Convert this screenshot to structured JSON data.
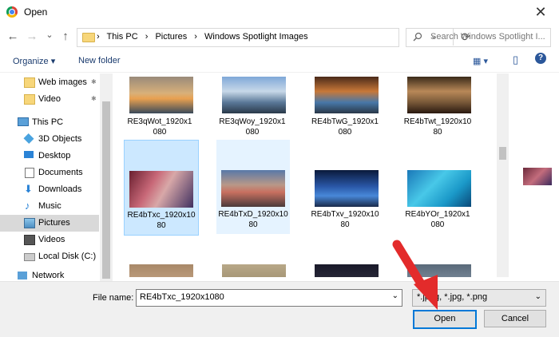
{
  "window": {
    "title": "Open",
    "close_glyph": "✕"
  },
  "nav": {
    "back": "←",
    "forward": "→",
    "recent": "⌄",
    "up": "↑"
  },
  "address": {
    "crumbs": [
      "This PC",
      "Pictures",
      "Windows Spotlight Images"
    ],
    "sep": "›",
    "dropdown": "⌄",
    "refresh": "⟳"
  },
  "search": {
    "placeholder": "Search Windows Spotlight I...",
    "icon_glyph": "🔍"
  },
  "toolbar": {
    "organize": "Organize ▾",
    "new_folder": "New folder",
    "view_glyph": "▦ ▾",
    "pane_glyph": "▯",
    "help_glyph": "?"
  },
  "sidebar": {
    "items": [
      {
        "label": "Web images",
        "icon": "folder-icon",
        "pinned": true
      },
      {
        "label": "Video",
        "icon": "folder-icon",
        "pinned": true
      },
      {
        "label": "This PC",
        "icon": "computer-icon"
      },
      {
        "label": "3D Objects",
        "icon": "cube-icon"
      },
      {
        "label": "Desktop",
        "icon": "desktop-icon"
      },
      {
        "label": "Documents",
        "icon": "document-icon"
      },
      {
        "label": "Downloads",
        "icon": "download-icon"
      },
      {
        "label": "Music",
        "icon": "music-icon"
      },
      {
        "label": "Pictures",
        "icon": "pictures-icon",
        "selected": true
      },
      {
        "label": "Videos",
        "icon": "videos-icon"
      },
      {
        "label": "Local Disk (C:)",
        "icon": "disk-icon"
      },
      {
        "label": "Network",
        "icon": "network-icon"
      }
    ],
    "pin_glyph": "📌"
  },
  "files": [
    {
      "name": "RE3qWot_1920x1080",
      "line1": "RE3qWot_1920x1",
      "line2": "080"
    },
    {
      "name": "RE3qWoy_1920x1080",
      "line1": "RE3qWoy_1920x1",
      "line2": "080"
    },
    {
      "name": "RE4bTwG_1920x1080",
      "line1": "RE4bTwG_1920x1",
      "line2": "080"
    },
    {
      "name": "RE4bTwt_1920x1080",
      "line1": "RE4bTwt_1920x10",
      "line2": "80"
    },
    {
      "name": "RE4bTxc_1920x1080",
      "line1": "RE4bTxc_1920x10",
      "line2": "80",
      "selected": true
    },
    {
      "name": "RE4bTxD_1920x1080",
      "line1": "RE4bTxD_1920x10",
      "line2": "80",
      "hover": true
    },
    {
      "name": "RE4bTxv_1920x1080",
      "line1": "RE4bTxv_1920x10",
      "line2": "80"
    },
    {
      "name": "RE4bYOr_1920x1080",
      "line1": "RE4bYOr_1920x1",
      "line2": "080"
    }
  ],
  "bottom": {
    "file_name_label": "File name:",
    "file_name_value": "RE4bTxc_1920x1080",
    "filter_text": "*.jpeg, *.jpg, *.png",
    "dropdown_glyph": "⌄",
    "open_label": "Open",
    "cancel_label": "Cancel"
  },
  "colors": {
    "accent": "#0078d7",
    "annotation_arrow": "#e32b2b",
    "selected_bg": "#cce8ff"
  }
}
